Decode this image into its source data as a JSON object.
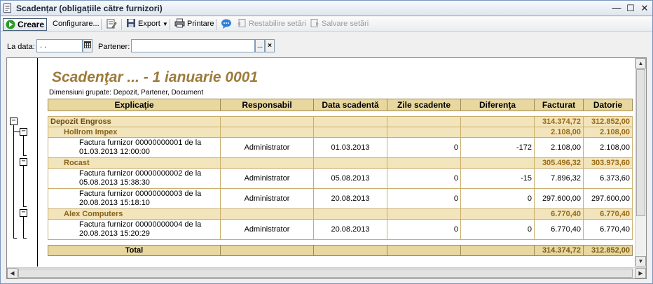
{
  "window": {
    "title": "Scadențar (obligațiile către furnizori)"
  },
  "toolbar": {
    "create_label": "Creare",
    "configure_label": "Configurare...",
    "export_label": "Export",
    "print_label": "Printare",
    "restore_label": "Restabilire setări",
    "save_label": "Salvare setări"
  },
  "filters": {
    "date_label": "La data:",
    "date_value": " .  .",
    "partner_label": "Partener:",
    "partner_value": "",
    "ellipsis": "...",
    "clear": "×"
  },
  "report": {
    "title": "Scadenţar ... - 1 ianuarie 0001",
    "subtitle": "Dimensiuni grupate: Depozit, Partener, Document",
    "columns": [
      "Explicaţie",
      "Responsabil",
      "Data scadentă",
      "Zile scadente",
      "Diferenţa",
      "Facturat",
      "Datorie"
    ],
    "depot": {
      "name": "Depozit Engross",
      "facturat": "314.374,72",
      "datorie": "312.852,00"
    },
    "partners": [
      {
        "name": "Hollrom Impex",
        "facturat": "2.108,00",
        "datorie": "2.108,00"
      },
      {
        "name": "Rocast",
        "facturat": "305.496,32",
        "datorie": "303.973,60"
      },
      {
        "name": "Alex Computers",
        "facturat": "6.770,40",
        "datorie": "6.770,40"
      }
    ],
    "rows": [
      {
        "explicatie": "Factura furnizor 00000000001 de la 01.03.2013 12:00:00",
        "responsabil": "Administrator",
        "data": "01.03.2013",
        "zile": "0",
        "diferenta": "-172",
        "facturat": "2.108,00",
        "datorie": "2.108,00"
      },
      {
        "explicatie": "Factura furnizor 00000000002 de la 05.08.2013 15:38:30",
        "responsabil": "Administrator",
        "data": "05.08.2013",
        "zile": "0",
        "diferenta": "-15",
        "facturat": "7.896,32",
        "datorie": "6.373,60"
      },
      {
        "explicatie": "Factura furnizor 00000000003 de la 20.08.2013 15:18:10",
        "responsabil": "Administrator",
        "data": "20.08.2013",
        "zile": "0",
        "diferenta": "0",
        "facturat": "297.600,00",
        "datorie": "297.600,00"
      },
      {
        "explicatie": "Factura furnizor 00000000004 de la 20.08.2013 15:20:29",
        "responsabil": "Administrator",
        "data": "20.08.2013",
        "zile": "0",
        "diferenta": "0",
        "facturat": "6.770,40",
        "datorie": "6.770,40"
      }
    ],
    "total": {
      "label": "Total",
      "facturat": "314.374,72",
      "datorie": "312.852,00"
    }
  },
  "colors": {
    "accent": "#9d7b3a",
    "header_fill": "#e8d8a0",
    "group_fill": "#f2e4bb"
  }
}
